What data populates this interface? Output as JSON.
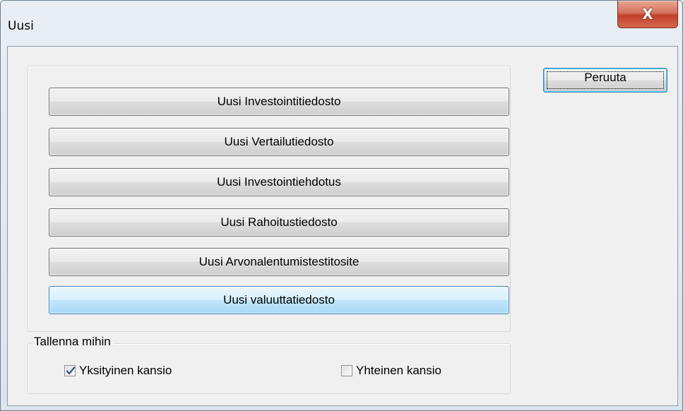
{
  "window": {
    "title": "Uusi",
    "close_glyph": "X"
  },
  "buttons": [
    {
      "label": "Uusi Investointitiedosto"
    },
    {
      "label": "Uusi Vertailutiedosto"
    },
    {
      "label": "Uusi Investointiehdotus"
    },
    {
      "label": "Uusi Rahoitustiedosto"
    },
    {
      "label": "Uusi Arvonalentumistestitosite"
    },
    {
      "label": "Uusi valuuttatiedosto"
    }
  ],
  "cancel_label": "Peruuta",
  "save_group": {
    "legend": "Tallenna mihin",
    "options": [
      {
        "label": "Yksityinen kansio",
        "checked": true
      },
      {
        "label": "Yhteinen kansio",
        "checked": false
      }
    ]
  },
  "colors": {
    "close_button": "#c2402a",
    "focus_accent": "#3c7fb1",
    "check_mark": "#2a4a8a"
  }
}
